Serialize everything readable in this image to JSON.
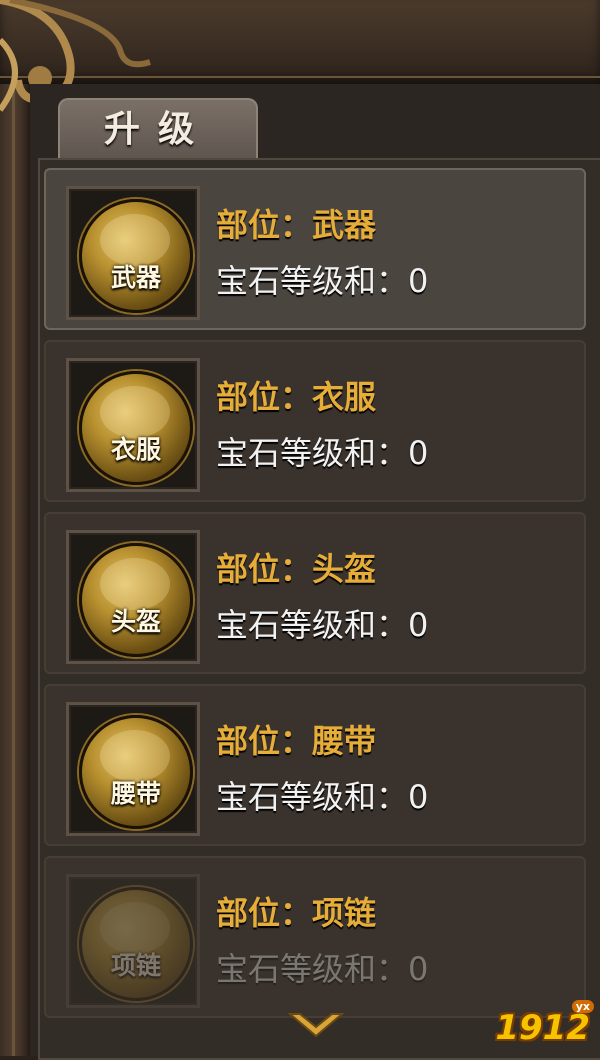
{
  "tab": {
    "label": "升级"
  },
  "items": [
    {
      "icon_label": "武器",
      "position_text": "部位：武器",
      "gem_text": "宝石等级和：0",
      "selected": true
    },
    {
      "icon_label": "衣服",
      "position_text": "部位：衣服",
      "gem_text": "宝石等级和：0"
    },
    {
      "icon_label": "头盔",
      "position_text": "部位：头盔",
      "gem_text": "宝石等级和：0"
    },
    {
      "icon_label": "腰带",
      "position_text": "部位：腰带",
      "gem_text": "宝石等级和：0"
    },
    {
      "icon_label": "项链",
      "position_text": "部位：项链",
      "gem_text": "宝石等级和：0"
    }
  ],
  "watermark": {
    "text": "1912",
    "badge": "yx"
  },
  "colors": {
    "accent": "#e7ad39",
    "panel": "#332d28"
  }
}
